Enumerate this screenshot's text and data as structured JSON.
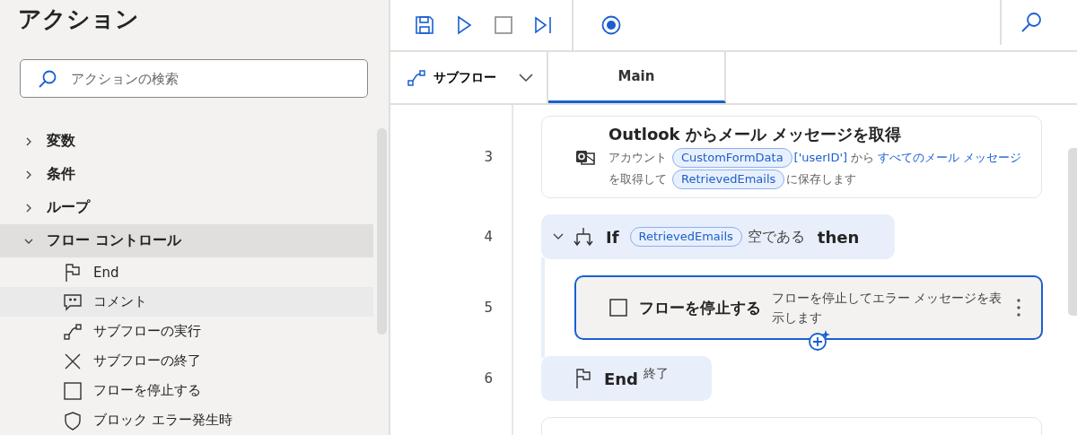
{
  "actions_panel": {
    "title": "アクション",
    "search": {
      "placeholder": "アクションの検索"
    },
    "groups": [
      {
        "label": "変数",
        "expanded": false,
        "selected": false
      },
      {
        "label": "条件",
        "expanded": false,
        "selected": false
      },
      {
        "label": "ループ",
        "expanded": false,
        "selected": false
      },
      {
        "label": "フロー コントロール",
        "expanded": true,
        "selected": true,
        "children": [
          {
            "label": "End",
            "kind": "flag",
            "selected": false
          },
          {
            "label": "コメント",
            "kind": "comment",
            "selected": true
          },
          {
            "label": "サブフローの実行",
            "kind": "subflow",
            "selected": false
          },
          {
            "label": "サブフローの終了",
            "kind": "cross",
            "selected": false
          },
          {
            "label": "フローを停止する",
            "kind": "square",
            "selected": false
          },
          {
            "label": "ブロック エラー発生時",
            "kind": "shield",
            "selected": false
          }
        ]
      }
    ]
  },
  "toolbar": {
    "left": [
      {
        "kind": "save"
      },
      {
        "kind": "run"
      },
      {
        "kind": "stop",
        "disabled": true
      },
      {
        "kind": "step"
      }
    ],
    "middle": [
      {
        "kind": "record"
      }
    ],
    "right": [
      {
        "kind": "search"
      }
    ]
  },
  "tabs": {
    "subflow_dropdown": {
      "label": "サブフロー"
    },
    "items": [
      {
        "label": "Main",
        "selected": true
      }
    ]
  },
  "steps": [
    {
      "number": "3",
      "kind": "action",
      "title": "Outlook からメール メッセージを取得",
      "selected": false,
      "segments": [
        {
          "kind": "text",
          "text": "アカウント"
        },
        {
          "kind": "var",
          "text": "CustomFormData"
        },
        {
          "kind": "link",
          "text": "['userID']"
        },
        {
          "kind": "text",
          "text": "から"
        },
        {
          "kind": "link",
          "text": "すべてのメール メッセージ"
        },
        {
          "kind": "text",
          "text": "を取得して"
        },
        {
          "kind": "var",
          "text": "RetrievedEmails"
        },
        {
          "kind": "text",
          "text": "に保存します"
        }
      ]
    },
    {
      "number": "4",
      "kind": "if",
      "expanded": true,
      "segments": [
        {
          "kind": "keyword",
          "text": "If"
        },
        {
          "kind": "var",
          "text": "RetrievedEmails"
        },
        {
          "kind": "text",
          "text": "空である"
        },
        {
          "kind": "keyword",
          "text": "then"
        }
      ],
      "children": [
        {
          "number": "5",
          "kind": "action",
          "title": "フローを停止する",
          "selected": true,
          "description": "フローを停止してエラー メッセージを表示します"
        }
      ]
    },
    {
      "number": "6",
      "kind": "end",
      "title": "End",
      "note": "終了"
    }
  ]
}
